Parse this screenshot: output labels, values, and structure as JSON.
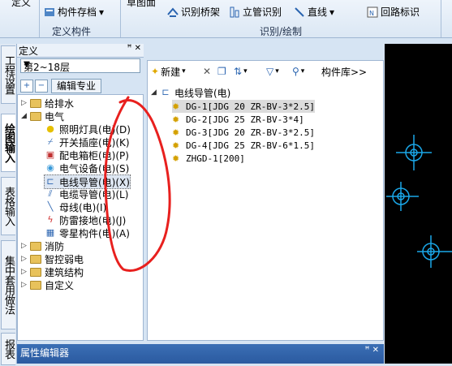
{
  "ribbon": {
    "top_left_partial": "定义",
    "component_storage": "构件存档",
    "dropdown_arrow": "▾",
    "top_partial_2": "草图面",
    "identify_bridge": "识别桥架",
    "identify_riser": "立管识别",
    "straight_line": "直线",
    "loop_mark": "回路标识",
    "group_define_component": "定义构件",
    "group_identify_draw": "识别/绘制"
  },
  "vertical_tabs": [
    "工程设置",
    "绘图输入",
    "表格输入",
    "集中套用做法",
    "报表"
  ],
  "left_panel": {
    "header": "定义",
    "pin": "ꟸ ✕",
    "floor_select_value": "第2~18层",
    "edit_profession_button": "编辑专业",
    "tree": [
      {
        "label": "给排水",
        "level": 0,
        "expanded": false,
        "folder": true
      },
      {
        "label": "电气",
        "level": 0,
        "expanded": true,
        "folder": true
      },
      {
        "label": "照明灯具(电)(D)",
        "level": 1,
        "icon": "lightbulb-icon"
      },
      {
        "label": "开关插座(电)(K)",
        "level": 1,
        "icon": "switch-icon"
      },
      {
        "label": "配电箱柜(电)(P)",
        "level": 1,
        "icon": "distribution-box-icon"
      },
      {
        "label": "电气设备(电)(S)",
        "level": 1,
        "icon": "equipment-icon"
      },
      {
        "label": "电线导管(电)(X)",
        "level": 1,
        "icon": "conduit-icon",
        "selected": true
      },
      {
        "label": "电缆导管(电)(L)",
        "level": 1,
        "icon": "cable-conduit-icon"
      },
      {
        "label": "母线(电)(I)",
        "level": 1,
        "icon": "busbar-icon"
      },
      {
        "label": "防雷接地(电)(J)",
        "level": 1,
        "icon": "lightning-icon"
      },
      {
        "label": "零星构件(电)(A)",
        "level": 1,
        "icon": "misc-component-icon"
      },
      {
        "label": "消防",
        "level": 0,
        "expanded": false,
        "folder": true
      },
      {
        "label": "智控弱电",
        "level": 0,
        "expanded": false,
        "folder": true
      },
      {
        "label": "建筑结构",
        "level": 0,
        "expanded": false,
        "folder": true
      },
      {
        "label": "自定义",
        "level": 0,
        "expanded": false,
        "folder": true
      }
    ]
  },
  "right_panel": {
    "toolbar": {
      "new_label": "新建",
      "component_library": "构件库>>"
    },
    "root_label": "电线导管(电)",
    "components": [
      {
        "label": "DG-1[JDG 20 ZR-BV-3*2.5]",
        "selected": true
      },
      {
        "label": "DG-2[JDG 25 ZR-BV-3*4]",
        "selected": false
      },
      {
        "label": "DG-3[JDG 20 ZR-BV-3*2.5]",
        "selected": false
      },
      {
        "label": "DG-4[JDG 25 ZR-BV-6*1.5]",
        "selected": false
      },
      {
        "label": "ZHGD-1[200]",
        "selected": false
      }
    ]
  },
  "property_editor": {
    "title": "属性编辑器",
    "controls": "ꟸ ✕"
  },
  "colors": {
    "canvas_bg": "#000000",
    "canvas_symbol": "#1aa7e8",
    "annotation": "#e8201e",
    "title_bar": "#2b5aa0"
  }
}
